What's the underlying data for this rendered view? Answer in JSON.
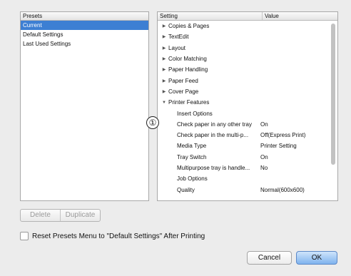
{
  "presets": {
    "header": "Presets",
    "items": [
      {
        "label": "Current",
        "selected": true
      },
      {
        "label": "Default Settings",
        "selected": false
      },
      {
        "label": "Last Used Settings",
        "selected": false
      }
    ]
  },
  "settings": {
    "col_setting": "Setting",
    "col_value": "Value",
    "rows": [
      {
        "name": "Copies & Pages",
        "value": "",
        "type": "collapsed"
      },
      {
        "name": "TextEdit",
        "value": "",
        "type": "collapsed"
      },
      {
        "name": "Layout",
        "value": "",
        "type": "collapsed"
      },
      {
        "name": "Color Matching",
        "value": "",
        "type": "collapsed"
      },
      {
        "name": "Paper Handling",
        "value": "",
        "type": "collapsed"
      },
      {
        "name": "Paper Feed",
        "value": "",
        "type": "collapsed"
      },
      {
        "name": "Cover Page",
        "value": "",
        "type": "collapsed"
      },
      {
        "name": "Printer Features",
        "value": "",
        "type": "expanded"
      },
      {
        "name": "Insert Options",
        "value": "",
        "type": "child"
      },
      {
        "name": "Check paper in any other tray",
        "value": "On",
        "type": "child"
      },
      {
        "name": "Check paper in the multi-p...",
        "value": "Off(Express Print)",
        "type": "child"
      },
      {
        "name": "Media Type",
        "value": "Printer Setting",
        "type": "child"
      },
      {
        "name": "Tray Switch",
        "value": "On",
        "type": "child"
      },
      {
        "name": "Multipurpose tray is handle...",
        "value": "No",
        "type": "child"
      },
      {
        "name": "Job Options",
        "value": "",
        "type": "child"
      },
      {
        "name": "Quality",
        "value": "Normal(600x600)",
        "type": "child"
      }
    ]
  },
  "callout_label": "①",
  "buttons": {
    "delete": "Delete",
    "duplicate": "Duplicate",
    "cancel": "Cancel",
    "ok": "OK"
  },
  "reset_checkbox": {
    "label": "Reset Presets Menu to \"Default Settings\" After Printing",
    "checked": false
  },
  "icons": {
    "collapsed": "disclosure-triangle-right-icon",
    "expanded": "disclosure-triangle-down-icon"
  },
  "colors": {
    "selection": "#3d7fd3",
    "default_button": "#7fb3ee"
  }
}
